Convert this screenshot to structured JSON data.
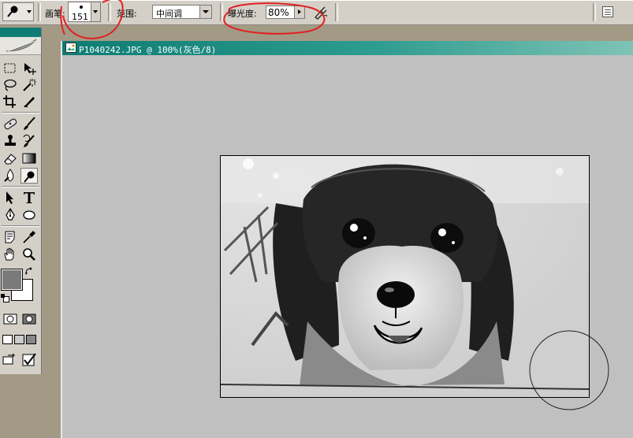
{
  "options_bar": {
    "brush_label": "画笔:",
    "brush_size": "151",
    "range_label": "范围:",
    "range_value": "中间调",
    "exposure_label": "曝光度:",
    "exposure_value": "80%",
    "tool_icon": "dodge-burn-icon",
    "airbrush_icon": "airbrush-icon",
    "palette_icon": "palette-well-icon"
  },
  "toolbox": {
    "tools": [
      "rect-marquee-icon",
      "move-icon",
      "lasso-icon",
      "magic-wand-icon",
      "crop-icon",
      "slice-icon",
      "healing-brush-icon",
      "brush-icon",
      "clone-stamp-icon",
      "history-brush-icon",
      "eraser-icon",
      "gradient-icon",
      "blur-icon",
      "dodge-icon",
      "path-select-icon",
      "type-icon",
      "pen-icon",
      "shape-icon",
      "notes-icon",
      "eyedropper-icon",
      "hand-icon",
      "zoom-icon"
    ],
    "foreground_color": "#7a7a7a",
    "background_color": "#ffffff"
  },
  "document": {
    "title": "P1040242.JPG @ 100%(灰色/8)",
    "mode": "灰色/8",
    "zoom": "100%"
  },
  "colors": {
    "titlebar": "#0e7c74",
    "workspace": "#c0c0c0",
    "annotation": "#e02020"
  }
}
